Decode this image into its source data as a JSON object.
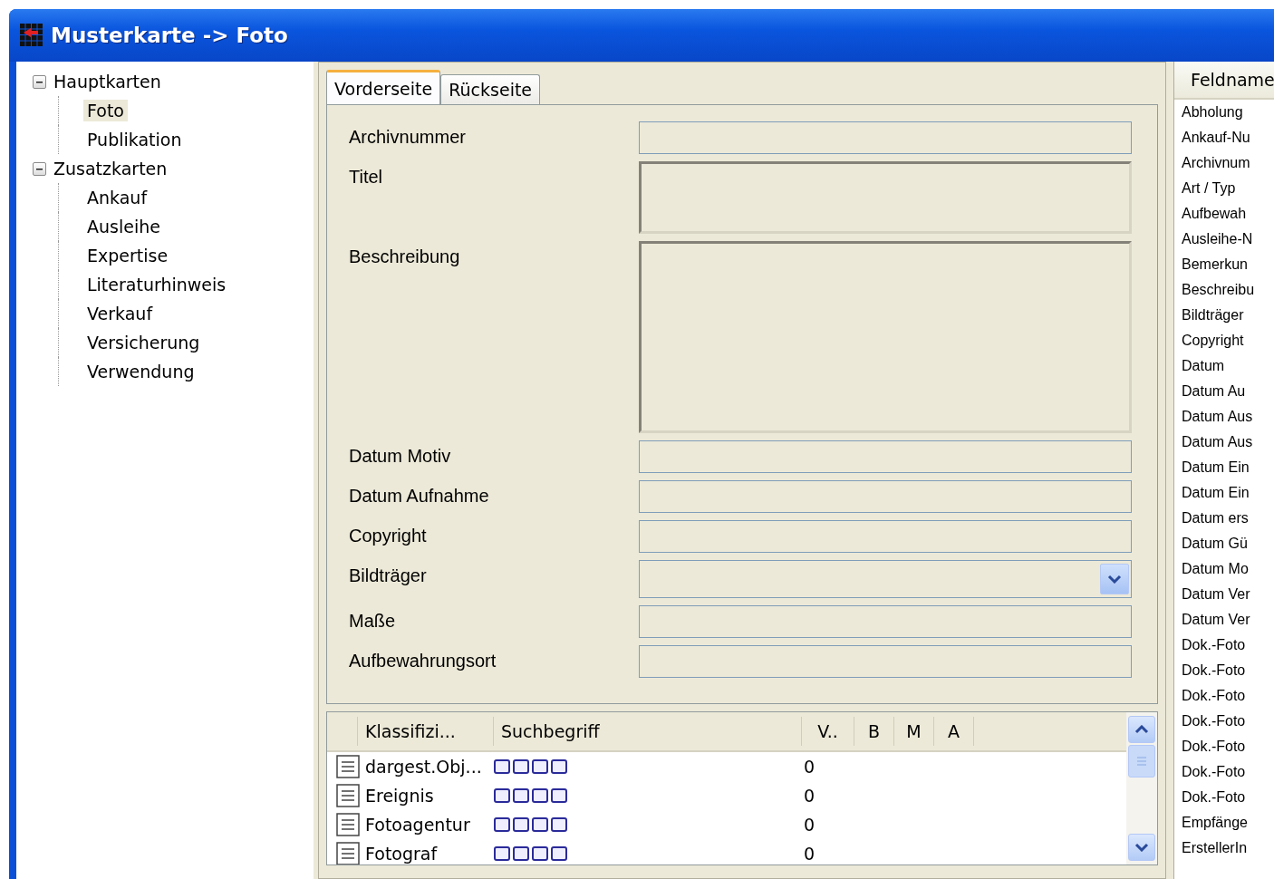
{
  "window": {
    "title": "Musterkarte -> Foto"
  },
  "tree": [
    {
      "label": "Hauptkarten",
      "expanded": true,
      "selected": false,
      "children": [
        {
          "label": "Foto",
          "selected": true
        },
        {
          "label": "Publikation",
          "selected": false
        }
      ]
    },
    {
      "label": "Zusatzkarten",
      "expanded": true,
      "selected": false,
      "children": [
        {
          "label": "Ankauf",
          "selected": false
        },
        {
          "label": "Ausleihe",
          "selected": false
        },
        {
          "label": "Expertise",
          "selected": false
        },
        {
          "label": "Literaturhinweis",
          "selected": false
        },
        {
          "label": "Verkauf",
          "selected": false
        },
        {
          "label": "Versicherung",
          "selected": false
        },
        {
          "label": "Verwendung",
          "selected": false
        }
      ]
    }
  ],
  "tabs": [
    {
      "label": "Vorderseite",
      "selected": true
    },
    {
      "label": "Rückseite",
      "selected": false
    }
  ],
  "fields": [
    {
      "label": "Archivnummer",
      "kind": "text"
    },
    {
      "label": "Titel",
      "kind": "memo"
    },
    {
      "label": "Beschreibung",
      "kind": "memo_large"
    },
    {
      "label": "Datum Motiv",
      "kind": "text"
    },
    {
      "label": "Datum Aufnahme",
      "kind": "text"
    },
    {
      "label": "Copyright",
      "kind": "text"
    },
    {
      "label": "Bildträger",
      "kind": "combo"
    },
    {
      "label": "Maße",
      "kind": "text"
    },
    {
      "label": "Aufbewahrungsort",
      "kind": "text"
    }
  ],
  "grid": {
    "columns": [
      "Klassifizi...",
      "Suchbegriff",
      "V..",
      "B",
      "M",
      "A"
    ],
    "rows": [
      {
        "klass": "dargest.Obj...",
        "count": "0"
      },
      {
        "klass": "Ereignis",
        "count": "0"
      },
      {
        "klass": "Fotoagentur",
        "count": "0"
      },
      {
        "klass": "Fotograf",
        "count": "0"
      }
    ]
  },
  "field_list": {
    "header": "Feldname",
    "items": [
      "Abholung",
      "Ankauf-Nu",
      "Archivnum",
      "Art / Typ",
      "Aufbewah",
      "Ausleihe-N",
      "Bemerkun",
      "Beschreibu",
      "Bildträger",
      "Copyright",
      "Datum",
      "Datum Au",
      "Datum Aus",
      "Datum Aus",
      "Datum Ein",
      "Datum Ein",
      "Datum ers",
      "Datum Gü",
      "Datum Mo",
      "Datum Ver",
      "Datum Ver",
      "Dok.-Foto",
      "Dok.-Foto",
      "Dok.-Foto",
      "Dok.-Foto",
      "Dok.-Foto",
      "Dok.-Foto",
      "Dok.-Foto",
      "Empfänge",
      "ErstellerIn"
    ]
  }
}
